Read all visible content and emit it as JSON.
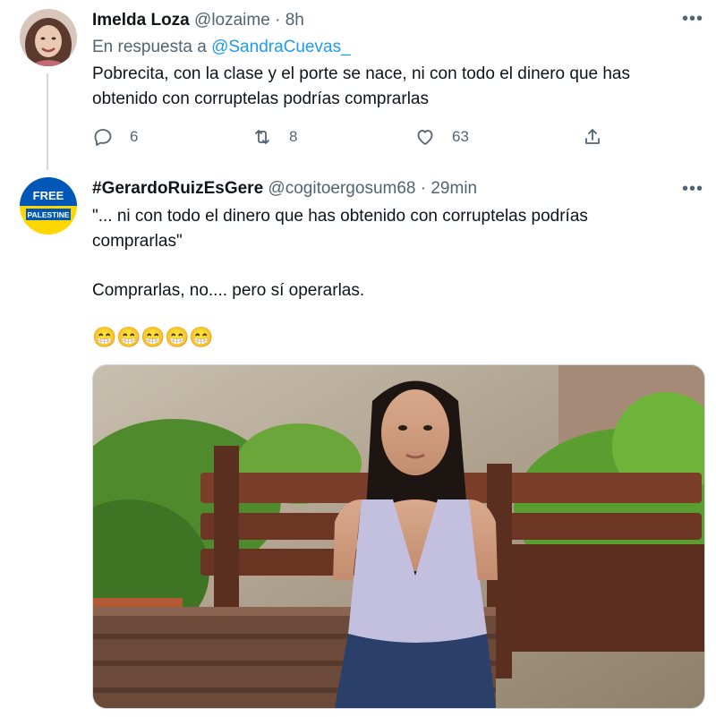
{
  "tweet1": {
    "name": "Imelda Loza",
    "handle": "@lozaime",
    "separator": "·",
    "time": "8h",
    "reply_prefix": "En respuesta a",
    "reply_handle": "@SandraCuevas_",
    "text_line1": "Pobrecita, con la clase y el porte se nace, ni con todo el dinero que has",
    "text_line2": "obtenido con corruptelas podrías comprarlas",
    "replies": "6",
    "retweets": "8",
    "likes": "63"
  },
  "tweet2": {
    "name": "#GerardoRuizEsGere",
    "handle": "@cogitoergosum68",
    "separator": "·",
    "time": "29min",
    "avatar_top": "FREE",
    "avatar_bottom": "PALESTINE",
    "quote_line1": "\"... ni con todo el dinero que has obtenido con corruptelas podrías",
    "quote_line2": "comprarlas\"",
    "text2": "Comprarlas, no.... pero sí operarlas.",
    "emojis": [
      "😁",
      "😁",
      "😁",
      "😁",
      "😁"
    ]
  },
  "icons": {
    "more": "more-icon",
    "reply": "reply-icon",
    "retweet": "retweet-icon",
    "like": "like-icon",
    "share": "share-icon"
  },
  "colors": {
    "link": "#1d9bf0",
    "secondary": "#536471",
    "ukraine_blue": "#0057b7",
    "ukraine_yellow": "#ffd700"
  }
}
